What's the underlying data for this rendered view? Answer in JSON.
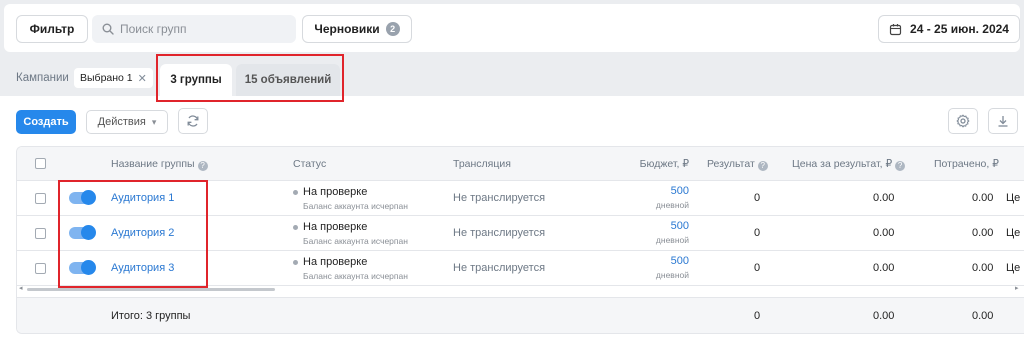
{
  "topbar": {
    "filter_label": "Фильтр",
    "search_placeholder": "Поиск групп",
    "drafts_label": "Черновики",
    "drafts_count": "2",
    "date_range": "24 - 25 июн. 2024"
  },
  "tabsbar": {
    "campaigns_label": "Кампании",
    "selected_chip": "Выбрано 1",
    "chip_close": "✕",
    "tab_groups": "3 группы",
    "tab_ads": "15 объявлений"
  },
  "toolbar": {
    "create_label": "Создать",
    "actions_label": "Действия",
    "actions_chevron": "▾"
  },
  "table": {
    "headers": {
      "name": "Название группы",
      "status": "Статус",
      "broadcast": "Трансляция",
      "budget": "Бюджет, ₽",
      "result": "Результат",
      "cost_per_result": "Цена за результат, ₽",
      "spent": "Потрачено, ₽"
    },
    "rows": [
      {
        "name": "Аудитория 1",
        "status": "На проверке",
        "status_note": "Баланс аккаунта исчерпан",
        "broadcast": "Не транслируется",
        "budget": "500",
        "budget_period": "дневной",
        "result": "0",
        "cost_per_result": "0.00",
        "spent": "0.00",
        "overflow": "Це"
      },
      {
        "name": "Аудитория 2",
        "status": "На проверке",
        "status_note": "Баланс аккаунта исчерпан",
        "broadcast": "Не транслируется",
        "budget": "500",
        "budget_period": "дневной",
        "result": "0",
        "cost_per_result": "0.00",
        "spent": "0.00",
        "overflow": "Це"
      },
      {
        "name": "Аудитория 3",
        "status": "На проверке",
        "status_note": "Баланс аккаунта исчерпан",
        "broadcast": "Не транслируется",
        "budget": "500",
        "budget_period": "дневной",
        "result": "0",
        "cost_per_result": "0.00",
        "spent": "0.00",
        "overflow": "Це"
      }
    ],
    "totals": {
      "label": "Итого: 3 группы",
      "result": "0",
      "cost_per_result": "0.00",
      "spent": "0.00"
    },
    "scroll_left_glyph": "◂",
    "scroll_right_glyph": "▸"
  },
  "theme": {
    "accent": "#2688eb",
    "link": "#2a78d2",
    "highlight": "#e0242b"
  },
  "icons": [
    "search-icon",
    "calendar-icon",
    "refresh-icon",
    "gear-icon",
    "download-icon",
    "help-icon",
    "toggle-icon"
  ]
}
